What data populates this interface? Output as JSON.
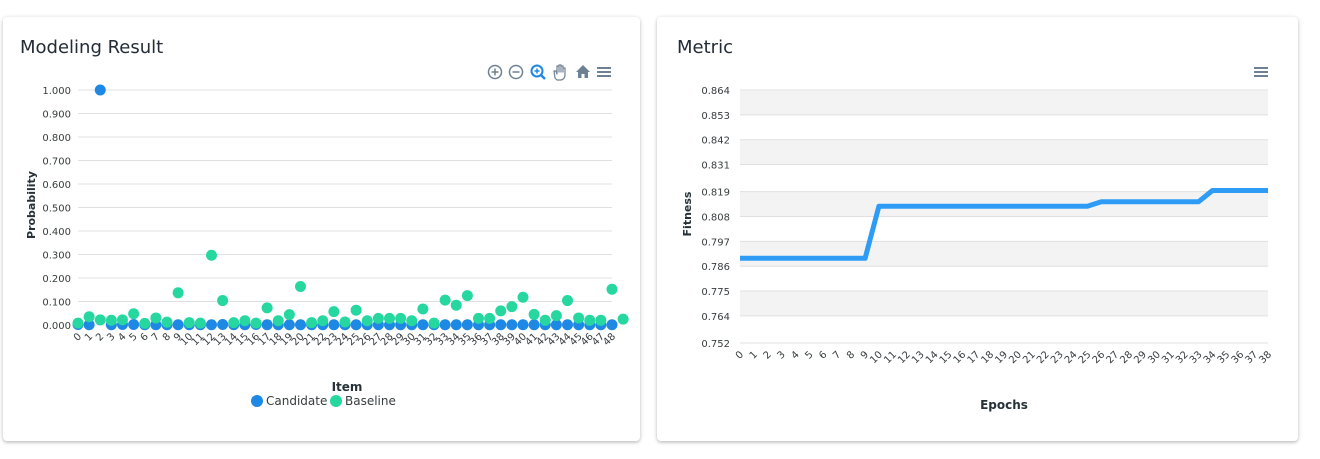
{
  "left_card": {
    "title": "Modeling Result",
    "toolbar": {
      "icons": [
        "zoom-in-icon",
        "zoom-out-icon",
        "selection-zoom-icon",
        "pan-hand-icon",
        "reset-home-icon",
        "menu-icon"
      ]
    }
  },
  "right_card": {
    "title": "Metric",
    "toolbar": {
      "icons": [
        "menu-icon"
      ]
    }
  },
  "chart_data": [
    {
      "type": "scatter",
      "xlabel": "Item",
      "ylabel": "Probability",
      "ylim": [
        0,
        1
      ],
      "yticks": [
        "0.000",
        "0.100",
        "0.200",
        "0.300",
        "0.400",
        "0.500",
        "0.600",
        "0.700",
        "0.800",
        "0.900",
        "1.000"
      ],
      "categories": [
        "0",
        "1",
        "2",
        "3",
        "4",
        "5",
        "6",
        "7",
        "8",
        "9",
        "10",
        "11",
        "12",
        "13",
        "14",
        "15",
        "16",
        "17",
        "18",
        "19",
        "20",
        "21",
        "22",
        "23",
        "24",
        "25",
        "26",
        "27",
        "28",
        "29",
        "30",
        "31",
        "32",
        "33",
        "34",
        "35",
        "36",
        "37",
        "38",
        "39",
        "40",
        "41",
        "42",
        "43",
        "44",
        "45",
        "46",
        "47",
        "48"
      ],
      "grid": true,
      "legend_position": "bottom",
      "series": [
        {
          "name": "Candidate",
          "color": "#1e88e5",
          "values": [
            0.002,
            0.001,
            1.0,
            0.001,
            0.002,
            0.002,
            0.001,
            0.001,
            0.001,
            0.001,
            0.001,
            0.001,
            0.001,
            0.002,
            0.001,
            0.001,
            0.002,
            0.001,
            0.001,
            0.001,
            0.001,
            0.001,
            0.001,
            0.001,
            0.001,
            0.001,
            0.001,
            0.001,
            0.001,
            0.001,
            0.001,
            0.001,
            0.001,
            0.001,
            0.001,
            0.001,
            0.001,
            0.001,
            0.001,
            0.001,
            0.001,
            0.001,
            0.001,
            0.001,
            0.001,
            0.001,
            0.001,
            0.001,
            0.001
          ]
        },
        {
          "name": "Baseline",
          "color": "#26d7a0",
          "values": [
            0.008,
            0.035,
            0.022,
            0.02,
            0.022,
            0.048,
            0.007,
            0.03,
            0.012,
            0.137,
            0.01,
            0.008,
            0.297,
            0.104,
            0.01,
            0.018,
            0.008,
            0.073,
            0.018,
            0.044,
            0.164,
            0.01,
            0.018,
            0.057,
            0.013,
            0.063,
            0.018,
            0.028,
            0.028,
            0.028,
            0.018,
            0.068,
            0.008,
            0.106,
            0.084,
            0.125,
            0.028,
            0.028,
            0.06,
            0.078,
            0.118,
            0.045,
            0.02,
            0.04,
            0.104,
            0.03,
            0.02,
            0.02,
            0.152,
            0.025
          ]
        }
      ]
    },
    {
      "type": "line",
      "xlabel": "Epochs",
      "ylabel": "Fitness",
      "ylim": [
        0.752,
        0.864
      ],
      "yticks": [
        "0.752",
        "0.764",
        "0.775",
        "0.786",
        "0.797",
        "0.808",
        "0.819",
        "0.831",
        "0.842",
        "0.853",
        "0.864"
      ],
      "x": [
        "0",
        "1",
        "2",
        "3",
        "4",
        "5",
        "6",
        "7",
        "8",
        "9",
        "10",
        "11",
        "12",
        "13",
        "14",
        "15",
        "16",
        "17",
        "18",
        "19",
        "20",
        "21",
        "22",
        "23",
        "24",
        "25",
        "26",
        "27",
        "28",
        "29",
        "30",
        "31",
        "32",
        "33",
        "34",
        "35",
        "36",
        "37",
        "38"
      ],
      "grid": true,
      "series": [
        {
          "color": "#2e9cf5",
          "values": [
            0.7895,
            0.7895,
            0.7895,
            0.7895,
            0.7895,
            0.7895,
            0.7895,
            0.7895,
            0.7895,
            0.7895,
            0.8125,
            0.8125,
            0.8125,
            0.8125,
            0.8125,
            0.8125,
            0.8125,
            0.8125,
            0.8125,
            0.8125,
            0.8125,
            0.8125,
            0.8125,
            0.8125,
            0.8125,
            0.8125,
            0.8145,
            0.8145,
            0.8145,
            0.8145,
            0.8145,
            0.8145,
            0.8145,
            0.8145,
            0.8195,
            0.8195,
            0.8195,
            0.8195,
            0.8195
          ]
        }
      ]
    }
  ]
}
